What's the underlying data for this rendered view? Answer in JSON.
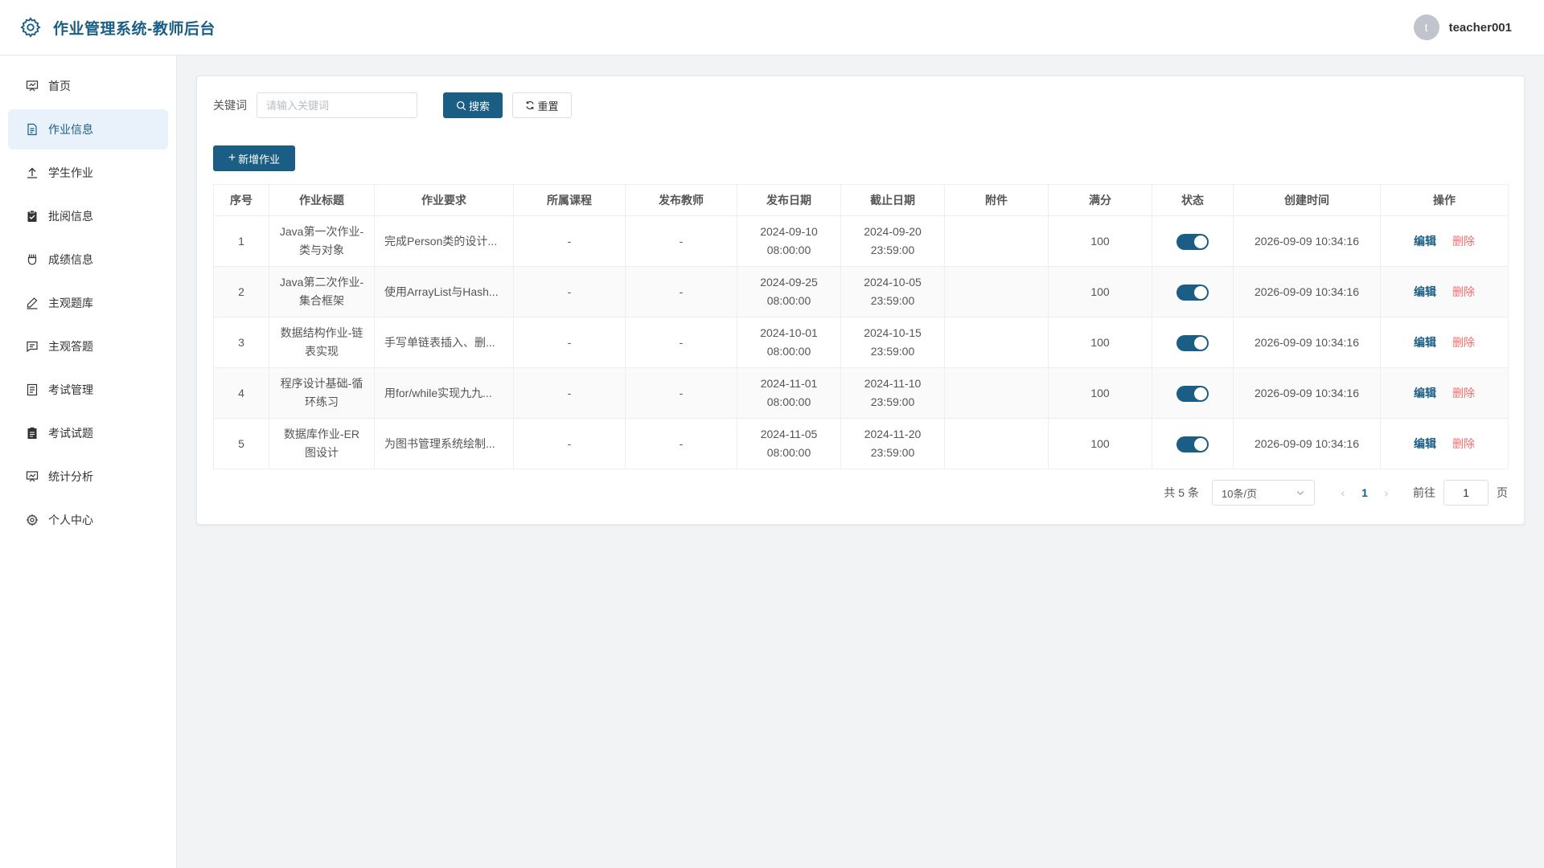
{
  "header": {
    "title": "作业管理系统-教师后台",
    "avatar_letter": "t",
    "username": "teacher001"
  },
  "sidebar": {
    "items": [
      {
        "label": "首页",
        "icon": "dashboard-icon"
      },
      {
        "label": "作业信息",
        "icon": "document-icon",
        "active": true
      },
      {
        "label": "学生作业",
        "icon": "upload-icon"
      },
      {
        "label": "批阅信息",
        "icon": "clipboard-icon"
      },
      {
        "label": "成绩信息",
        "icon": "grade-icon"
      },
      {
        "label": "主观题库",
        "icon": "edit-pen-icon"
      },
      {
        "label": "主观答题",
        "icon": "chat-icon"
      },
      {
        "label": "考试管理",
        "icon": "notebook-icon"
      },
      {
        "label": "考试试题",
        "icon": "paper-icon"
      },
      {
        "label": "统计分析",
        "icon": "chart-icon"
      },
      {
        "label": "个人中心",
        "icon": "gear-icon"
      }
    ]
  },
  "search": {
    "label": "关键词",
    "placeholder": "请输入关键词",
    "search_button": "搜索",
    "reset_button": "重置"
  },
  "add_button": "新增作业",
  "table": {
    "headers": [
      "序号",
      "作业标题",
      "作业要求",
      "所属课程",
      "发布教师",
      "发布日期",
      "截止日期",
      "附件",
      "满分",
      "状态",
      "创建时间",
      "操作"
    ],
    "rows": [
      {
        "index": "1",
        "title_line1": "Java第一次作业-",
        "title_line2": "类与对象",
        "requirement": "完成Person类的设计...",
        "course": "-",
        "teacher": "-",
        "publish_date": "2024-09-10",
        "publish_time": "08:00:00",
        "deadline_date": "2024-09-20",
        "deadline_time": "23:59:00",
        "attachment": "",
        "full_score": "100",
        "status_on": true,
        "created_at": "2026-09-09 10:34:16"
      },
      {
        "index": "2",
        "title_line1": "Java第二次作业-",
        "title_line2": "集合框架",
        "requirement": "使用ArrayList与Hash...",
        "course": "-",
        "teacher": "-",
        "publish_date": "2024-09-25",
        "publish_time": "08:00:00",
        "deadline_date": "2024-10-05",
        "deadline_time": "23:59:00",
        "attachment": "",
        "full_score": "100",
        "status_on": true,
        "created_at": "2026-09-09 10:34:16"
      },
      {
        "index": "3",
        "title_line1": "数据结构作业-链",
        "title_line2": "表实现",
        "requirement": "手写单链表插入、删...",
        "course": "-",
        "teacher": "-",
        "publish_date": "2024-10-01",
        "publish_time": "08:00:00",
        "deadline_date": "2024-10-15",
        "deadline_time": "23:59:00",
        "attachment": "",
        "full_score": "100",
        "status_on": true,
        "created_at": "2026-09-09 10:34:16"
      },
      {
        "index": "4",
        "title_line1": "程序设计基础-循",
        "title_line2": "环练习",
        "requirement": "用for/while实现九九...",
        "course": "-",
        "teacher": "-",
        "publish_date": "2024-11-01",
        "publish_time": "08:00:00",
        "deadline_date": "2024-11-10",
        "deadline_time": "23:59:00",
        "attachment": "",
        "full_score": "100",
        "status_on": true,
        "created_at": "2026-09-09 10:34:16"
      },
      {
        "index": "5",
        "title_line1": "数据库作业-ER",
        "title_line2": "图设计",
        "requirement": "为图书管理系统绘制...",
        "course": "-",
        "teacher": "-",
        "publish_date": "2024-11-05",
        "publish_time": "08:00:00",
        "deadline_date": "2024-11-20",
        "deadline_time": "23:59:00",
        "attachment": "",
        "full_score": "100",
        "status_on": true,
        "created_at": "2026-09-09 10:34:16"
      }
    ],
    "actions": {
      "edit": "编辑",
      "delete": "删除"
    }
  },
  "pagination": {
    "total_text": "共 5 条",
    "page_size": "10条/页",
    "prev": "‹",
    "current_page": "1",
    "next": "›",
    "goto_label": "前往",
    "goto_value": "1",
    "page_suffix": "页"
  },
  "colors": {
    "primary": "#1a5e85",
    "danger": "#f56c6c",
    "active_bg": "#e9f1fb"
  }
}
